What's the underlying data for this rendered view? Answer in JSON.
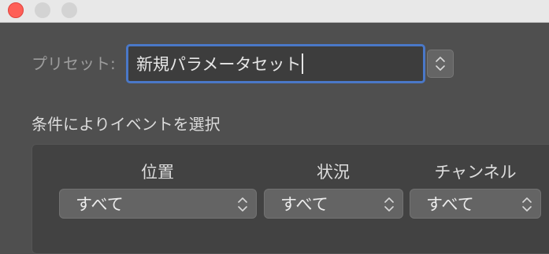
{
  "window": {
    "controls": [
      "close",
      "minimize",
      "maximize"
    ]
  },
  "preset": {
    "label": "プリセット:",
    "value": "新規パラメータセット"
  },
  "section": {
    "title": "条件によりイベントを選択"
  },
  "columns": [
    {
      "header": "位置",
      "selected": "すべて"
    },
    {
      "header": "状況",
      "selected": "すべて"
    },
    {
      "header": "チャンネル",
      "selected": "すべて"
    }
  ],
  "icons": {
    "stepper": "up-down-chevron-icon"
  },
  "colors": {
    "accent": "#4a78c8",
    "close": "#fe5f57",
    "background": "#4f4f4f"
  }
}
